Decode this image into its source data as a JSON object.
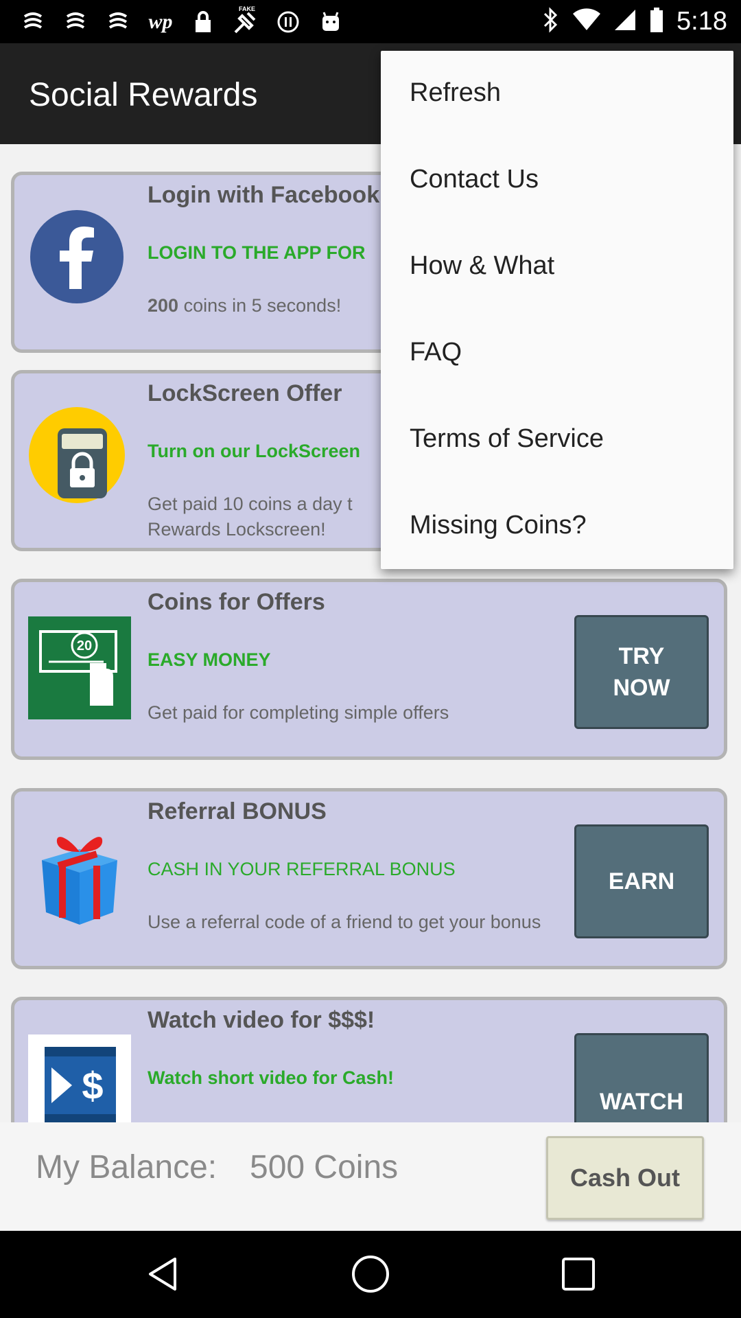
{
  "status_bar": {
    "time": "5:18",
    "left_icons": [
      "notification-icon",
      "notification-icon",
      "notification-icon",
      "wp-icon",
      "lock-icon",
      "fake-gps-icon",
      "pause-icon",
      "android-icon"
    ],
    "wp_label": "wp",
    "fake_label": "FAKE"
  },
  "app_bar": {
    "title": "Social Rewards"
  },
  "cards": [
    {
      "title": "Login with Facebook",
      "subtitle": "LOGIN TO THE APP FOR",
      "desc_bold": "200",
      "desc": " coins in 5 seconds!",
      "icon": "facebook-icon"
    },
    {
      "title": "LockScreen Offer",
      "subtitle": "Turn on our LockScreen",
      "desc": "Get paid 10 coins a day t Rewards Lockscreen!",
      "icon": "lockscreen-icon"
    },
    {
      "title": "Coins for Offers",
      "subtitle": "EASY MONEY",
      "desc": "Get paid for completing simple offers",
      "button": "TRY\nNOW",
      "icon": "cash-offer-icon",
      "icon_value": "20"
    },
    {
      "title": "Referral BONUS",
      "subtitle": "CASH IN YOUR REFERRAL BONUS",
      "desc": "Use a referral code of a friend to get your bonus",
      "button": "EARN",
      "icon": "gift-icon"
    },
    {
      "title": "Watch video for $$$!",
      "subtitle": "Watch short video for Cash!",
      "button": "WATCH",
      "icon": "video-cash-icon"
    }
  ],
  "balance": {
    "label": "My Balance:",
    "value": "500 Coins",
    "cashout_label": "Cash Out"
  },
  "menu": {
    "items": [
      "Refresh",
      "Contact Us",
      "How & What",
      "FAQ",
      "Terms of Service",
      "Missing Coins?"
    ]
  },
  "nav_bar": {
    "icons": [
      "back-icon",
      "home-icon",
      "recents-icon"
    ]
  },
  "colors": {
    "card_bg": "#cccce6",
    "accent_green": "#2aaa2a",
    "button_bg": "#546e7a",
    "facebook_blue": "#3b5998"
  }
}
